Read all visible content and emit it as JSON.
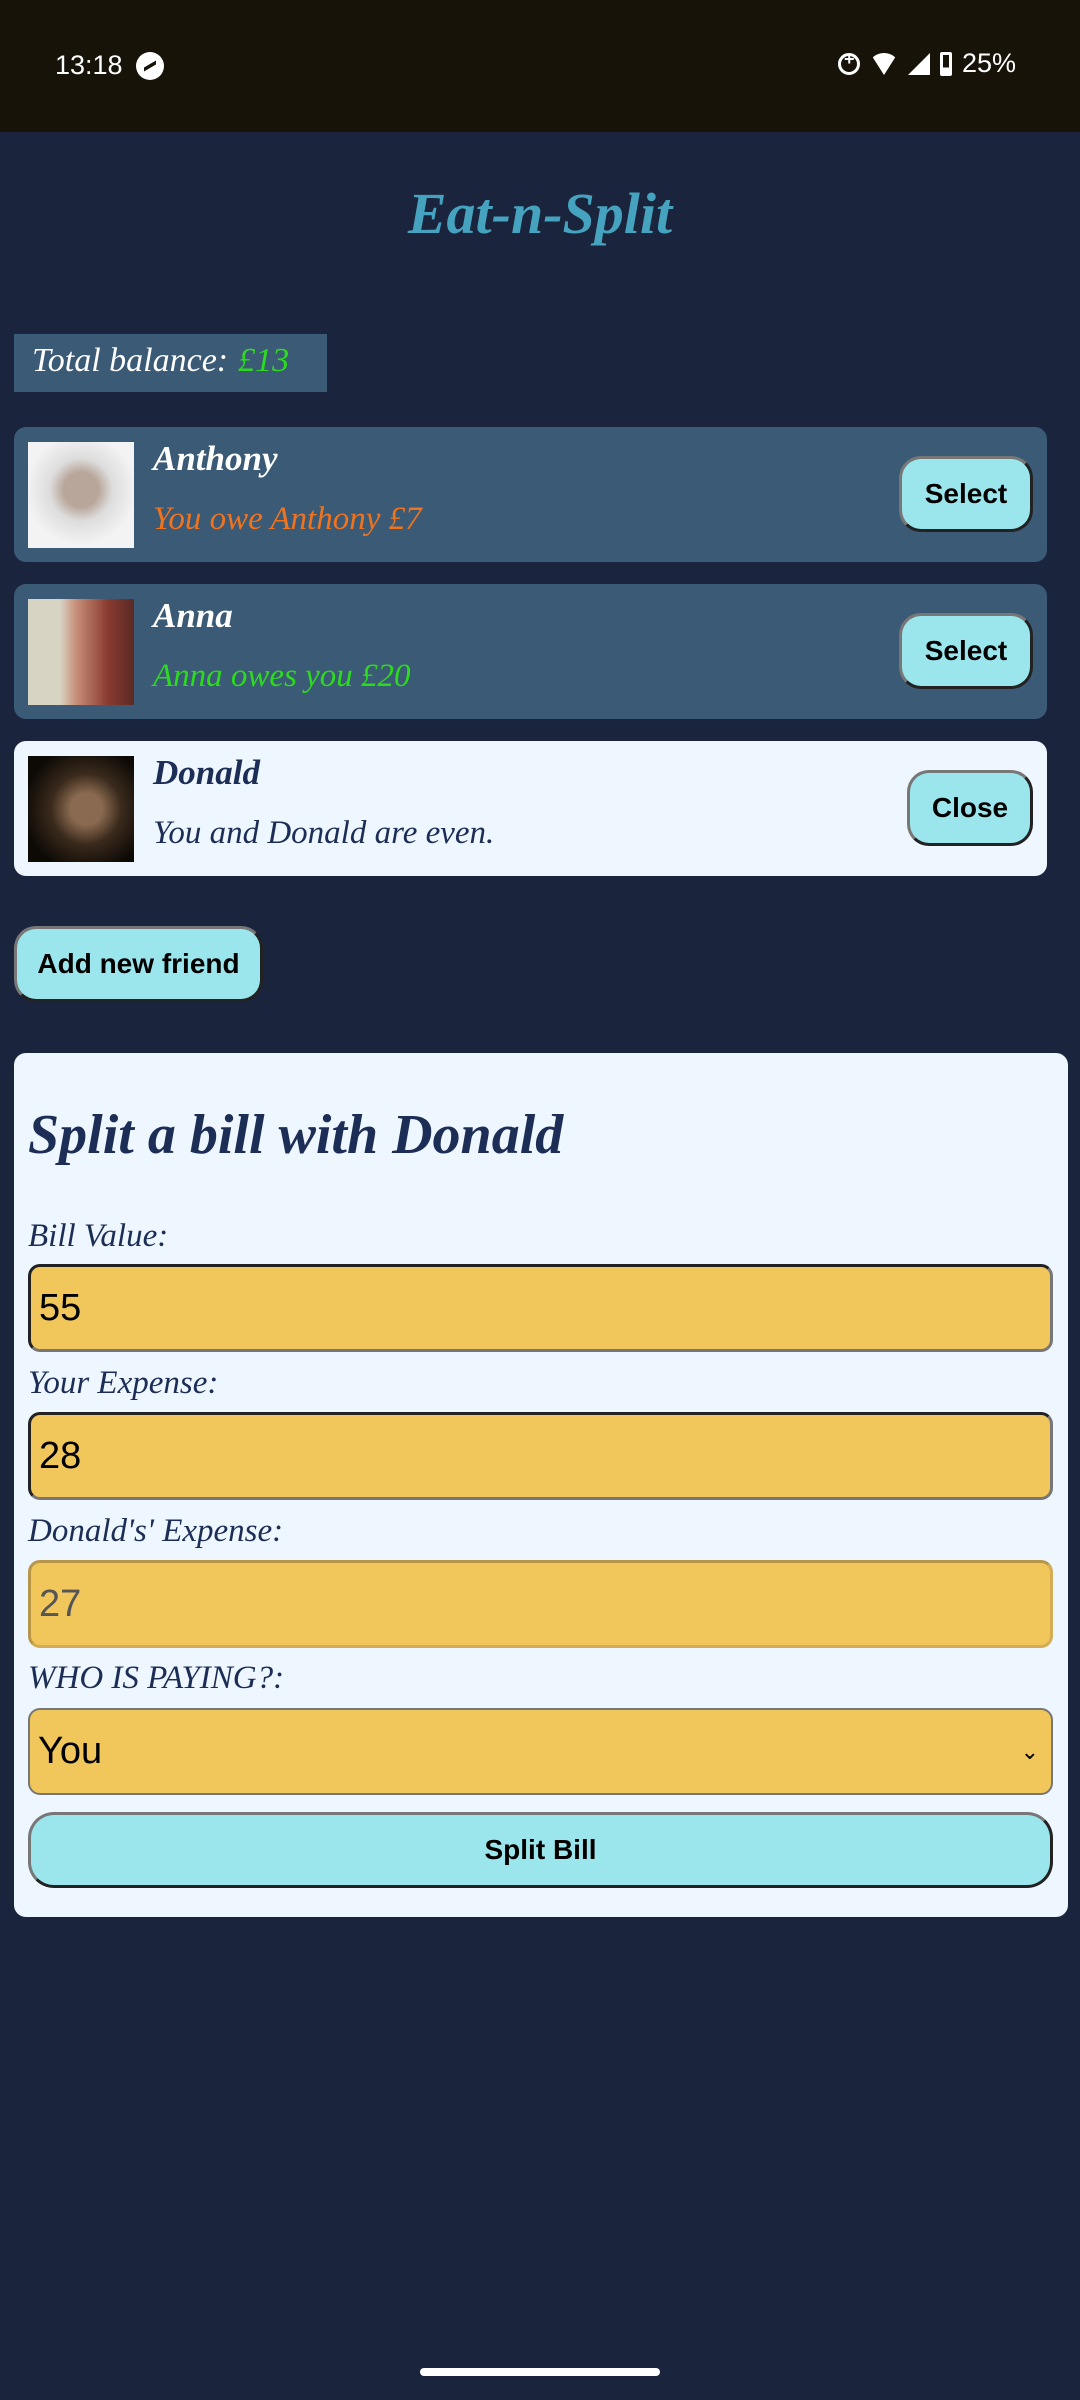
{
  "status_bar": {
    "time": "13:18",
    "battery": "25%",
    "icons": [
      "messenger-icon",
      "data-saver-icon",
      "wifi-icon",
      "signal-icon",
      "battery-icon"
    ]
  },
  "app": {
    "title": "Eat-n-Split"
  },
  "balance": {
    "label": "Total balance:",
    "amount": "£13",
    "amount_color": "#2ddb1e"
  },
  "friends": [
    {
      "name": "Anthony",
      "message": "You owe Anthony £7",
      "message_color": "#f0731e",
      "button": "Select",
      "selected": false
    },
    {
      "name": "Anna",
      "message": "Anna owes you £20",
      "message_color": "#2ddb1e",
      "button": "Select",
      "selected": false
    },
    {
      "name": "Donald",
      "message": "You and Donald are even.",
      "message_color": "#1c2e55",
      "button": "Close",
      "selected": true
    }
  ],
  "add_friend_button": "Add new friend",
  "split_form": {
    "heading": "Split a bill with Donald",
    "bill_label": "Bill Value:",
    "bill_value": "55",
    "your_label": "Your Expense:",
    "your_value": "28",
    "friend_label": "Donald's' Expense:",
    "friend_value": "27",
    "payer_label": "WHO IS PAYING?:",
    "payer_value": "You",
    "submit": "Split Bill"
  }
}
